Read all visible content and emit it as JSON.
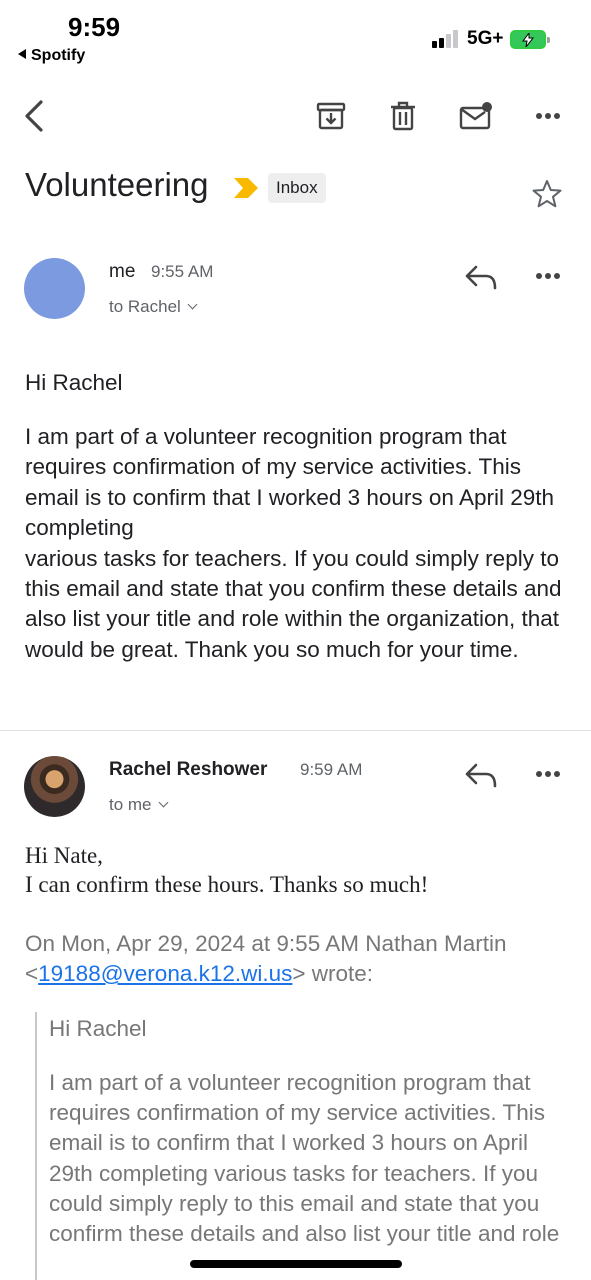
{
  "status_bar": {
    "time": "9:59",
    "back_app": "Spotify",
    "network": "5G+"
  },
  "toolbar": {
    "icons": [
      "back-chevron-icon",
      "archive-icon",
      "trash-icon",
      "mark-unread-icon",
      "more-icon"
    ]
  },
  "thread": {
    "subject": "Volunteering",
    "label": "Inbox",
    "label_color": "#f9b900"
  },
  "messages": [
    {
      "sender": "me",
      "time": "9:55 AM",
      "to": "to Rachel",
      "avatar_color": "#7b9ae0",
      "body": [
        "Hi Rachel",
        "I am part of a volunteer recognition program that requires confirmation of my service activities. This email is to confirm that I worked 3 hours on April 29th completing\nvarious tasks for teachers. If you could simply reply to this email and state that you confirm these details and also list your title and role within the organization, that would be great. Thank you so much for your time."
      ]
    },
    {
      "sender": "Rachel Reshower",
      "time": "9:59 AM",
      "to": "to me",
      "body_lines": [
        "Hi Nate,",
        "I can confirm these hours. Thanks so much!"
      ],
      "quote": {
        "header_prefix": "On Mon, Apr 29, 2024 at 9:55 AM Nathan Martin <",
        "email": "19188@verona.k12.wi.us",
        "header_suffix": "> wrote:",
        "greeting": "Hi Rachel",
        "body": "I am part of a volunteer recognition program that requires confirmation of my service activities. This email is to confirm that I worked 3 hours on April 29th completing various tasks for teachers. If you could simply reply to this email and state that you confirm these details and also list your title and role"
      }
    }
  ],
  "colors": {
    "link": "#1a73e8",
    "muted": "#5f6368",
    "quoted_text": "#777777"
  }
}
